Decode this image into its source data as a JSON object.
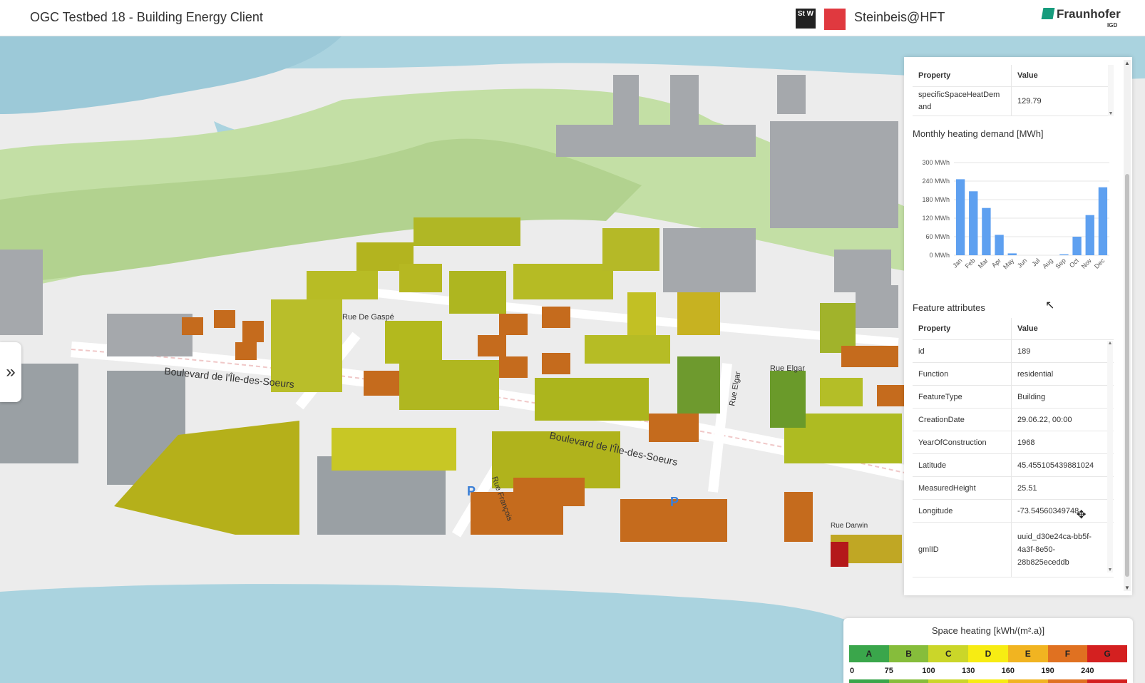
{
  "header": {
    "title": "OGC Testbed 18 - Building Energy Client",
    "stw_logo_text": "St W",
    "partner_name": "Steinbeis@HFT",
    "org_name": "Fraunhofer",
    "org_sub": "IGD"
  },
  "map": {
    "streets": [
      "Boulevard de l'Île-des-Soeurs",
      "Boulevard de l'Île-des-Soeurs",
      "Rue De Gaspé",
      "Rue Elgar",
      "Rue Elgar",
      "Rue François",
      "Rue Darwin"
    ],
    "parking_label": "P",
    "side_toggle": "»"
  },
  "panel": {
    "top_table": {
      "header_property": "Property",
      "header_value": "Value",
      "rows": [
        {
          "property": "specificSpaceHeatDem\nand",
          "value": "129.79"
        }
      ]
    },
    "chart_title": "Monthly heating demand [MWh]",
    "feature_title": "Feature attributes",
    "feature_table": {
      "header_property": "Property",
      "header_value": "Value",
      "rows": [
        {
          "property": "id",
          "value": "189"
        },
        {
          "property": "Function",
          "value": "residential"
        },
        {
          "property": "FeatureType",
          "value": "Building"
        },
        {
          "property": "CreationDate",
          "value": "29.06.22, 00:00"
        },
        {
          "property": "YearOfConstruction",
          "value": "1968"
        },
        {
          "property": "Latitude",
          "value": "45.455105439881024"
        },
        {
          "property": "MeasuredHeight",
          "value": "25.51"
        },
        {
          "property": "Longitude",
          "value": "-73.54560349748"
        },
        {
          "property": "gmlID",
          "value": "uuid_d30e24ca-bb5f-\n4a3f-8e50-\n28b825eceddb"
        }
      ]
    }
  },
  "chart_data": {
    "type": "bar",
    "title": "Monthly heating demand [MWh]",
    "categories": [
      "Jan",
      "Feb",
      "Mar",
      "Apr",
      "May",
      "Jun",
      "Jul",
      "Aug",
      "Sep",
      "Oct",
      "Nov",
      "Dec"
    ],
    "values": [
      246,
      207,
      153,
      66,
      6,
      0,
      0,
      0,
      3,
      60,
      130,
      220
    ],
    "ylim": [
      0,
      300
    ],
    "yticks": [
      "0 MWh",
      "60 MWh",
      "120 MWh",
      "180 MWh",
      "240 MWh",
      "300 MWh"
    ],
    "bar_color": "#5ea0f0",
    "grid": true
  },
  "legend": {
    "title": "Space heating [kWh/(m².a)]",
    "classes": [
      {
        "label": "A",
        "color": "#3aa64b"
      },
      {
        "label": "B",
        "color": "#86bd3b"
      },
      {
        "label": "C",
        "color": "#cbd629"
      },
      {
        "label": "D",
        "color": "#f7ec13"
      },
      {
        "label": "E",
        "color": "#f1b421"
      },
      {
        "label": "F",
        "color": "#e07121"
      },
      {
        "label": "G",
        "color": "#d42020"
      }
    ],
    "ticks": [
      "0",
      "75",
      "100",
      "130",
      "160",
      "190",
      "240"
    ]
  }
}
